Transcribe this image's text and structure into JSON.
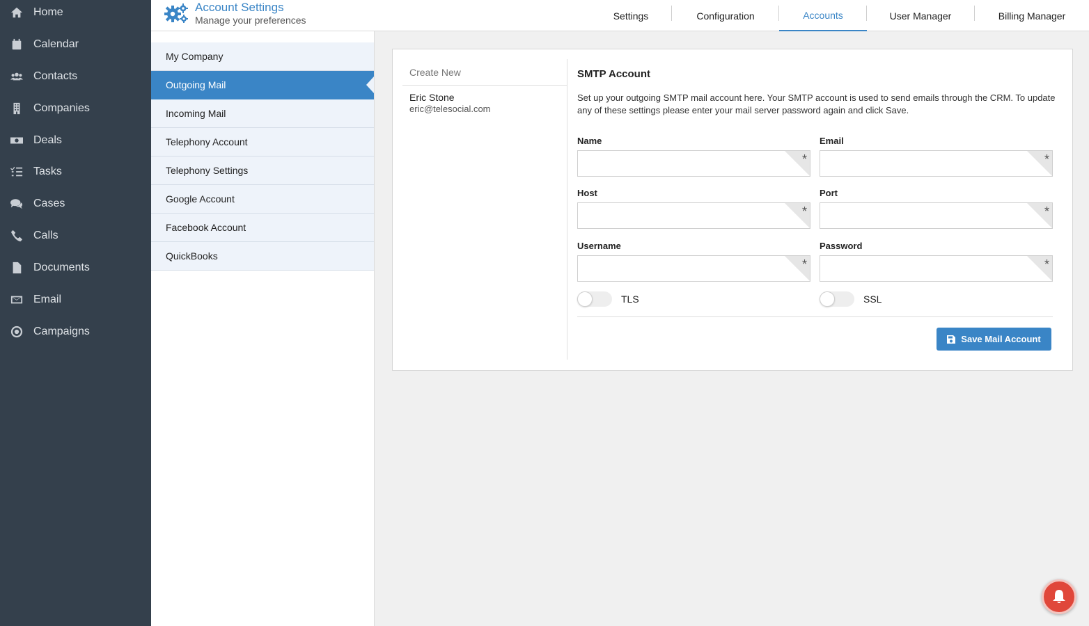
{
  "nav": {
    "items": [
      {
        "label": "Home",
        "icon": "home-icon"
      },
      {
        "label": "Calendar",
        "icon": "calendar-icon"
      },
      {
        "label": "Contacts",
        "icon": "contacts-icon"
      },
      {
        "label": "Companies",
        "icon": "building-icon"
      },
      {
        "label": "Deals",
        "icon": "money-icon"
      },
      {
        "label": "Tasks",
        "icon": "tasks-icon"
      },
      {
        "label": "Cases",
        "icon": "comments-icon"
      },
      {
        "label": "Calls",
        "icon": "phone-icon"
      },
      {
        "label": "Documents",
        "icon": "document-icon"
      },
      {
        "label": "Email",
        "icon": "envelope-icon"
      },
      {
        "label": "Campaigns",
        "icon": "target-icon"
      }
    ]
  },
  "header": {
    "title": "Account Settings",
    "subtitle": "Manage your preferences",
    "tabs": [
      {
        "label": "Settings"
      },
      {
        "label": "Configuration"
      },
      {
        "label": "Accounts",
        "active": true
      },
      {
        "label": "User Manager"
      },
      {
        "label": "Billing Manager"
      }
    ]
  },
  "settings_menu": {
    "items": [
      {
        "label": "My Company"
      },
      {
        "label": "Outgoing Mail",
        "active": true
      },
      {
        "label": "Incoming Mail"
      },
      {
        "label": "Telephony Account"
      },
      {
        "label": "Telephony Settings"
      },
      {
        "label": "Google Account"
      },
      {
        "label": "Facebook Account"
      },
      {
        "label": "QuickBooks"
      }
    ]
  },
  "accounts": {
    "create_new": "Create New",
    "entries": [
      {
        "name": "Eric Stone",
        "email": "eric@telesocial.com"
      }
    ]
  },
  "form": {
    "title": "SMTP Account",
    "description": "Set up your outgoing SMTP mail account here. Your SMTP account is used to send emails through the CRM. To update any of these settings please enter your mail server password again and click Save.",
    "fields": {
      "name": {
        "label": "Name",
        "value": ""
      },
      "email": {
        "label": "Email",
        "value": ""
      },
      "host": {
        "label": "Host",
        "value": ""
      },
      "port": {
        "label": "Port",
        "value": ""
      },
      "username": {
        "label": "Username",
        "value": ""
      },
      "password": {
        "label": "Password",
        "value": ""
      }
    },
    "required_marker": "*",
    "tls": {
      "label": "TLS",
      "on": false
    },
    "ssl": {
      "label": "SSL",
      "on": false
    },
    "save_label": "Save Mail Account"
  },
  "colors": {
    "accent": "#3a85c6",
    "sidebar": "#34404c",
    "notification": "#e0473a"
  }
}
